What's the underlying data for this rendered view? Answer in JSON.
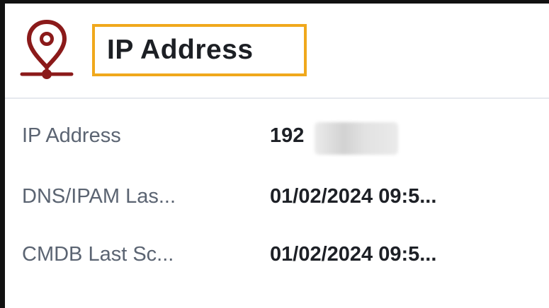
{
  "header": {
    "icon": "location-pin-icon",
    "title": "IP Address",
    "accent_color": "#8b1a1a",
    "highlight_color": "#f0a81c"
  },
  "fields": [
    {
      "label": "IP Address",
      "value": "192"
    },
    {
      "label": "DNS/IPAM Las...",
      "value": "01/02/2024 09:5..."
    },
    {
      "label": "CMDB Last Sc...",
      "value": "01/02/2024 09:5..."
    }
  ]
}
